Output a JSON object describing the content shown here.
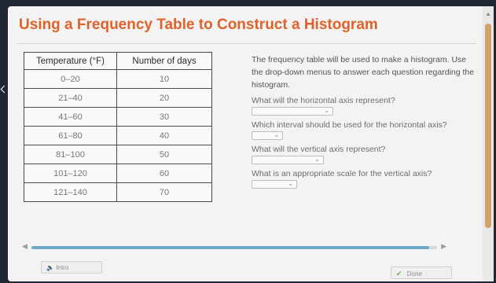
{
  "title": "Using a Frequency Table to Construct a Histogram",
  "table": {
    "headers": [
      "Temperature (°F)",
      "Number of days"
    ],
    "rows": [
      [
        "0–20",
        "10"
      ],
      [
        "21–40",
        "20"
      ],
      [
        "41–60",
        "30"
      ],
      [
        "61–80",
        "40"
      ],
      [
        "81–100",
        "50"
      ],
      [
        "101–120",
        "60"
      ],
      [
        "121–140",
        "70"
      ]
    ]
  },
  "instructions": "The frequency table will be used to make a histogram. Use the drop-down menus to answer each question regarding the histogram.",
  "questions": [
    {
      "label": "What will the horizontal axis represent?",
      "value": ""
    },
    {
      "label": "Which interval should be used for the horizontal axis?",
      "value": ""
    },
    {
      "label": "What will the vertical axis represent?",
      "value": ""
    },
    {
      "label": "What is an appropriate scale for the vertical axis?",
      "value": ""
    }
  ],
  "footer": {
    "intro_label": "Intro",
    "done_label": "Done",
    "progress": 0.98
  },
  "colors": {
    "title": "#e0622a",
    "progress": "#6aa9c9",
    "done_check": "#6aa84f"
  },
  "icons": {
    "intro": "speaker-icon",
    "done": "check-icon",
    "dropdown": "chevron-down-icon"
  }
}
